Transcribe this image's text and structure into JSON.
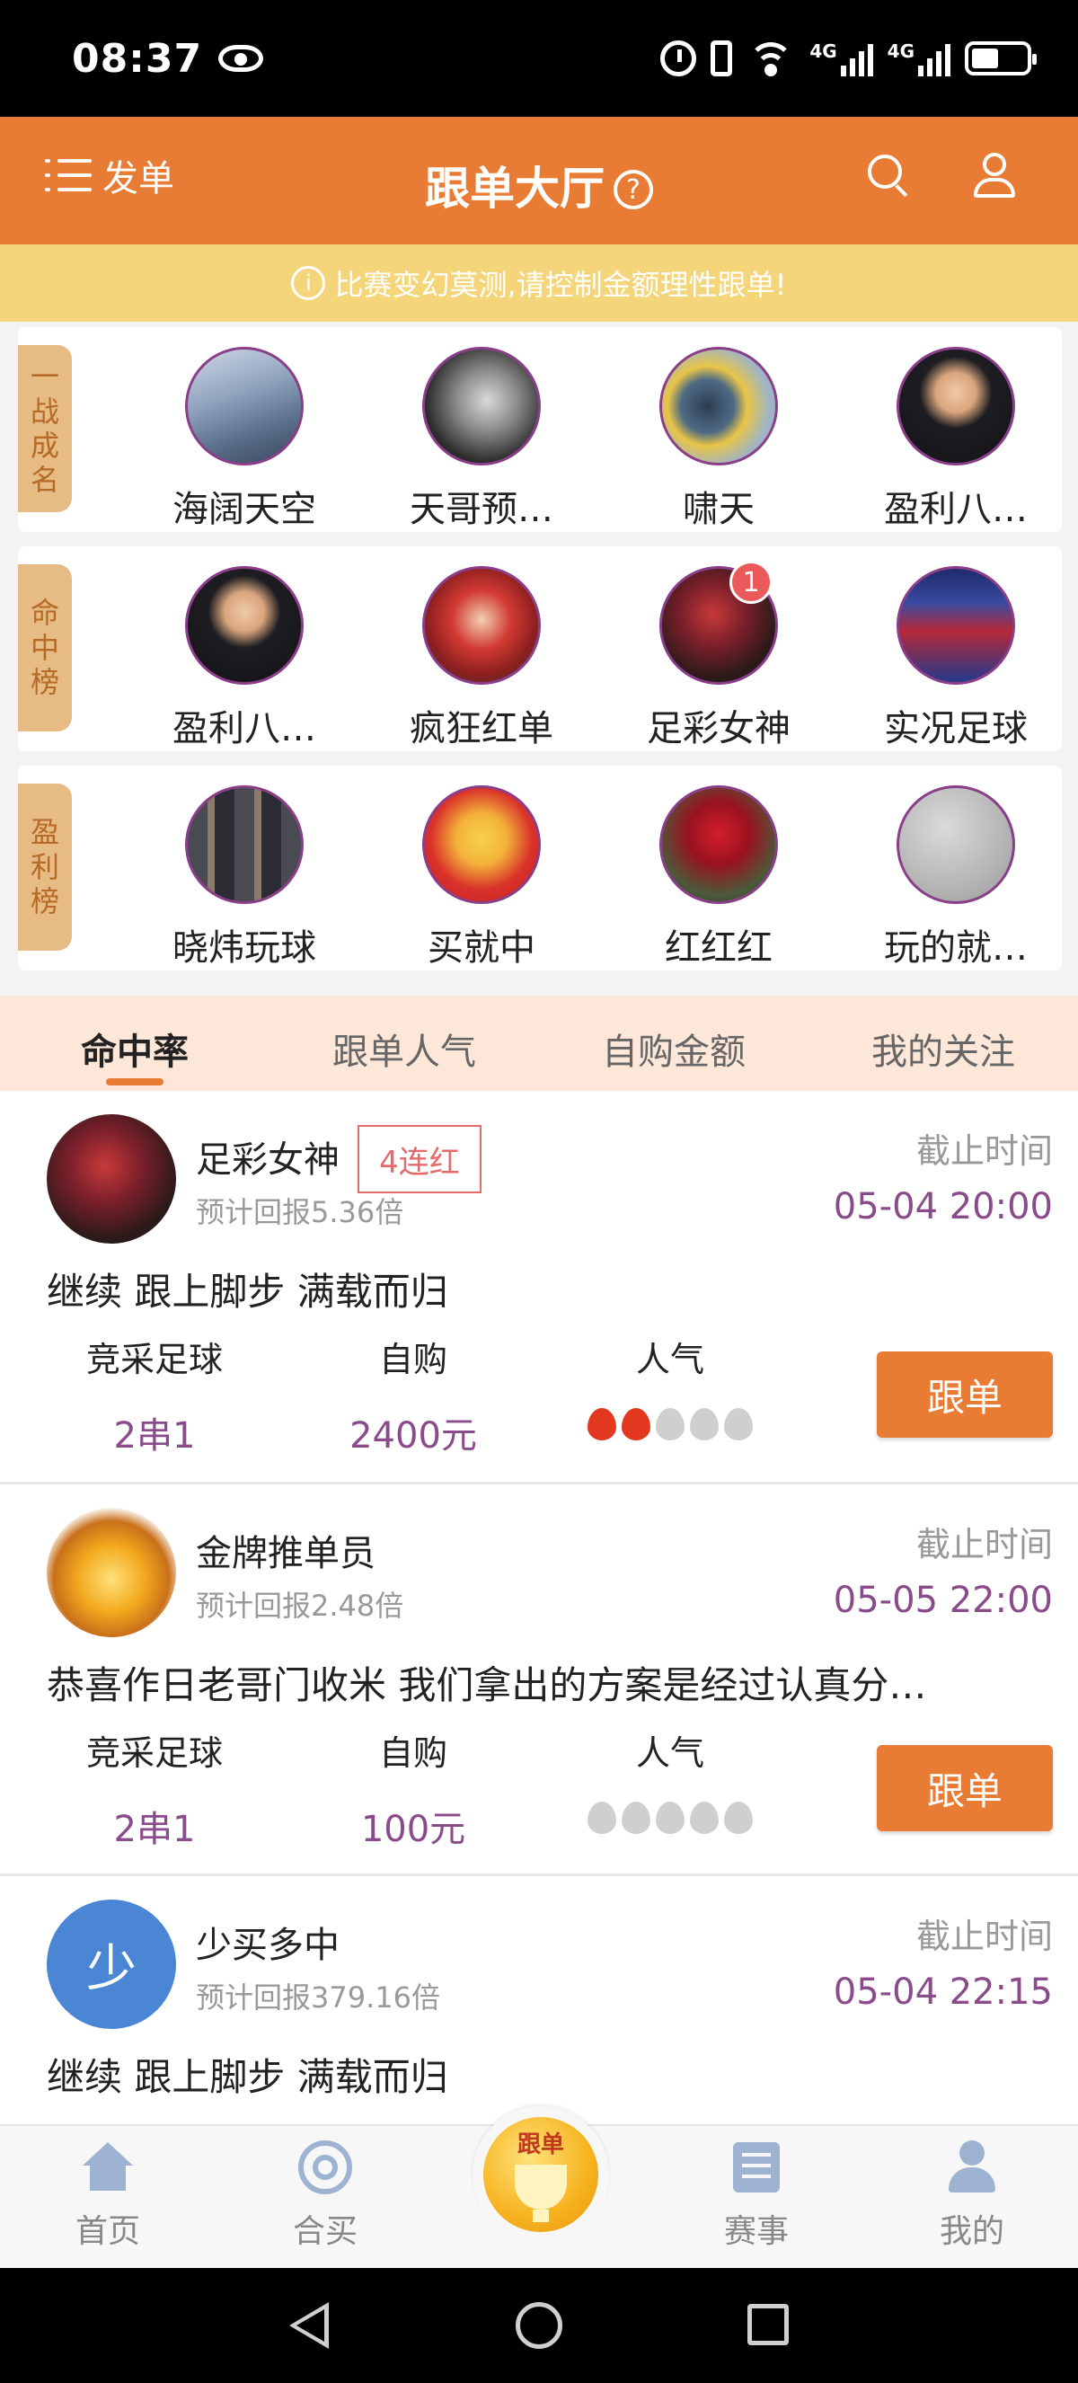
{
  "status_bar": {
    "time": "08:37",
    "net1": "4G",
    "net2": "4G"
  },
  "header": {
    "menu_label": "发单",
    "title": "跟单大厅",
    "help_glyph": "?"
  },
  "notice": {
    "text": "比赛变幻莫测,请控制金额理性跟单!"
  },
  "rankings": [
    {
      "tag": [
        "一",
        "战",
        "成",
        "名"
      ],
      "users": [
        {
          "name": "海阔天空"
        },
        {
          "name": "天哥预…"
        },
        {
          "name": "啸天"
        },
        {
          "name": "盈利八…"
        }
      ]
    },
    {
      "tag": [
        "命",
        "中",
        "榜"
      ],
      "users": [
        {
          "name": "盈利八…"
        },
        {
          "name": "疯狂红单"
        },
        {
          "name": "足彩女神",
          "badge": "1"
        },
        {
          "name": "实况足球"
        }
      ]
    },
    {
      "tag": [
        "盈",
        "利",
        "榜"
      ],
      "users": [
        {
          "name": "晓炜玩球"
        },
        {
          "name": "买就中"
        },
        {
          "name": "红红红"
        },
        {
          "name": "玩的就…"
        }
      ]
    }
  ],
  "tabs": [
    {
      "label": "命中率",
      "active": true
    },
    {
      "label": "跟单人气"
    },
    {
      "label": "自购金额"
    },
    {
      "label": "我的关注"
    }
  ],
  "cards": [
    {
      "name": "足彩女神",
      "streak": "4连红",
      "return": "预计回报5.36倍",
      "deadline_label": "截止时间",
      "deadline": "05-04 20:00",
      "desc": "继续 跟上脚步 满载而归",
      "stat1_label": "竞采足球",
      "stat1_value": "2串1",
      "stat2_label": "自购",
      "stat2_value": "2400元",
      "stat3_label": "人气",
      "popularity": 2,
      "button": "跟单"
    },
    {
      "name": "金牌推单员",
      "return": "预计回报2.48倍",
      "deadline_label": "截止时间",
      "deadline": "05-05 22:00",
      "desc": "恭喜作日老哥门收米 我们拿出的方案是经过认真分…",
      "stat1_label": "竞采足球",
      "stat1_value": "2串1",
      "stat2_label": "自购",
      "stat2_value": "100元",
      "stat3_label": "人气",
      "popularity": 0,
      "button": "跟单"
    },
    {
      "name": "少买多中",
      "avatar_letter": "少",
      "return": "预计回报379.16倍",
      "deadline_label": "截止时间",
      "deadline": "05-04 22:15",
      "desc": "继续 跟上脚步 满载而归"
    }
  ],
  "bottom_nav": [
    {
      "label": "首页",
      "icon": "home-icon"
    },
    {
      "label": "合买",
      "icon": "target-icon"
    },
    {
      "label": "跟单",
      "icon": "trophy-icon"
    },
    {
      "label": "赛事",
      "icon": "list-icon"
    },
    {
      "label": "我的",
      "icon": "profile-icon"
    }
  ],
  "colors": {
    "accent": "#e97c34",
    "notice": "#f5d57a",
    "rank_tag": "#e7bb84",
    "value": "#8a4b8a",
    "flame_hot": "#e2381f"
  }
}
